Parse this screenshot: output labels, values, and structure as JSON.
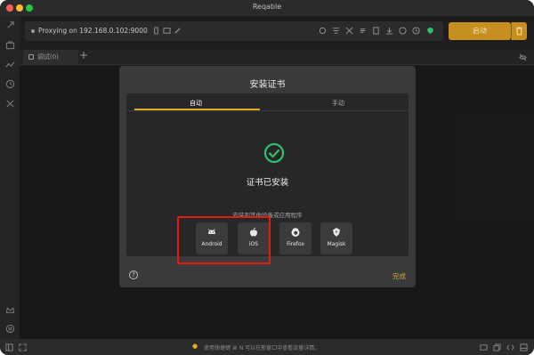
{
  "window": {
    "title": "Reqable"
  },
  "toolbar": {
    "proxy_status": "Proxying on 192.168.0.102:9000",
    "start_label": "启动"
  },
  "tabs": [
    {
      "label": "调试(0)"
    }
  ],
  "dialog": {
    "title": "安装证书",
    "tabs": {
      "auto": "自动",
      "manual": "手动"
    },
    "installed_text": "证书已安装",
    "install_other_text": "安装到其他设备或应用程序",
    "platforms": [
      {
        "label": "Android",
        "icon": "android-icon"
      },
      {
        "label": "iOS",
        "icon": "apple-icon"
      },
      {
        "label": "Firefox",
        "icon": "firefox-icon"
      },
      {
        "label": "Magisk",
        "icon": "magisk-icon"
      }
    ],
    "help_glyph": "?",
    "done_label": "完成"
  },
  "statusbar": {
    "hint": "使用快捷键 ⌘ N 可以在新窗口中查看流量详情。"
  },
  "colors": {
    "accent": "#e3a726",
    "success": "#2fc26b",
    "highlight": "#e11c12"
  }
}
